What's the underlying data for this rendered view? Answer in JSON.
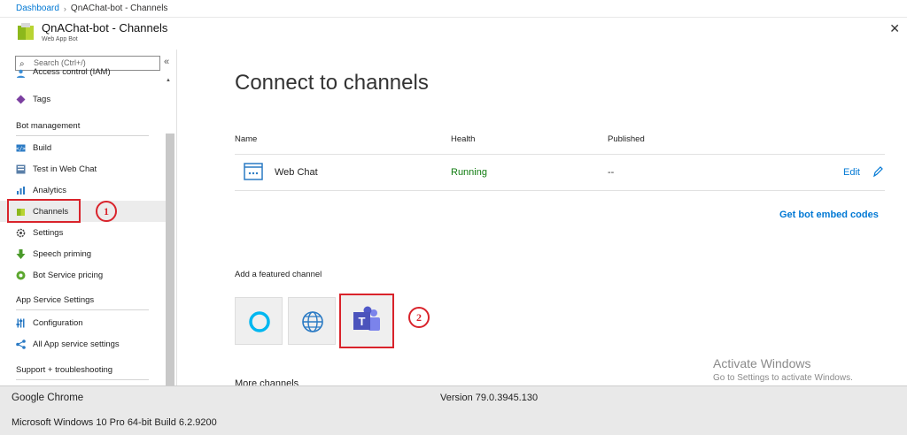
{
  "breadcrumb": {
    "items": [
      "Dashboard",
      "QnAChat-bot - Channels"
    ]
  },
  "header": {
    "title": "QnAChat-bot - Channels",
    "subtitle": "Web App Bot",
    "close": "✕"
  },
  "sidebar": {
    "search_placeholder": "Search (Ctrl+/)",
    "collapse": "«",
    "items_top": [
      {
        "label": "Access control (IAM)",
        "icon": "people-icon"
      },
      {
        "label": "Tags",
        "icon": "tag-icon"
      }
    ],
    "section_bot": "Bot management",
    "bot_items": [
      {
        "label": "Build",
        "icon": "code-icon"
      },
      {
        "label": "Test in Web Chat",
        "icon": "chat-icon"
      },
      {
        "label": "Analytics",
        "icon": "chart-icon"
      },
      {
        "label": "Channels",
        "icon": "channels-icon"
      },
      {
        "label": "Settings",
        "icon": "gear-icon"
      },
      {
        "label": "Speech priming",
        "icon": "download-icon"
      },
      {
        "label": "Bot Service pricing",
        "icon": "pricing-icon"
      }
    ],
    "section_app": "App Service Settings",
    "app_items": [
      {
        "label": "Configuration",
        "icon": "sliders-icon"
      },
      {
        "label": "All App service settings",
        "icon": "network-icon"
      }
    ],
    "section_support": "Support + troubleshooting"
  },
  "annotations": {
    "step1": "1",
    "step2": "2",
    "color": "#d9232b"
  },
  "main": {
    "title": "Connect to channels",
    "table": {
      "headers": [
        "Name",
        "Health",
        "Published"
      ],
      "rows": [
        {
          "name": "Web Chat",
          "health": "Running",
          "published": "--",
          "action": "Edit"
        }
      ]
    },
    "embed_link": "Get bot embed codes",
    "featured_header": "Add a featured channel",
    "featured_channels": [
      "cortana-icon",
      "web-icon",
      "teams-icon"
    ],
    "manage_header": "More channels"
  },
  "watermark": {
    "line1": "Activate Windows",
    "line2": "Go to Settings to activate Windows."
  },
  "footer": {
    "browser": "Google Chrome",
    "version": "Version 79.0.3945.130",
    "os": "Microsoft Windows 10 Pro 64-bit Build 6.2.9200"
  },
  "colors": {
    "accent": "#0078d4",
    "running": "#107c10",
    "teams": "#5059c9"
  }
}
